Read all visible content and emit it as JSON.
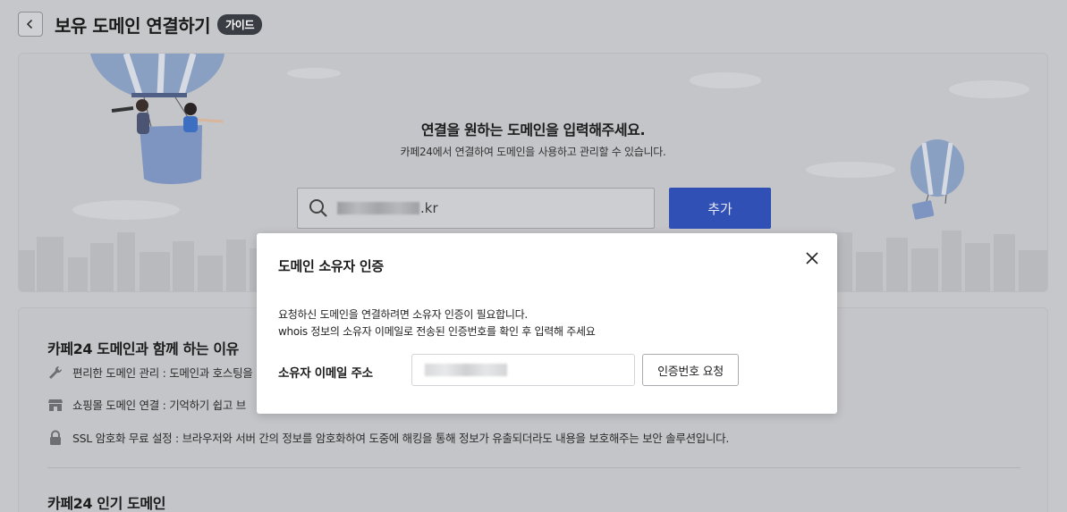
{
  "header": {
    "title": "보유 도메인 연결하기",
    "guide_badge": "가이드"
  },
  "hero": {
    "title": "연결을 원하는 도메인을 입력해주세요.",
    "subtitle": "카페24에서 연결하여 도메인을 사용하고 관리할 수 있습니다.",
    "search_suffix": ".kr",
    "add_button": "추가"
  },
  "info": {
    "title": "카페24 도메인과 함께 하는 이유",
    "benefits": [
      {
        "icon": "wrench-icon",
        "text": "편리한 도메인 관리 : 도메인과 호스팅을"
      },
      {
        "icon": "store-icon",
        "text": "쇼핑몰 도메인 연결 : 기억하기 쉽고 브"
      },
      {
        "icon": "lock-icon",
        "text": "SSL 암호화 무료 설정 : 브라우저와 서버 간의 정보를 암호화하여 도중에 해킹을 통해 정보가 유출되더라도 내용을 보호해주는 보안 솔루션입니다."
      }
    ],
    "popular_title": "카페24 인기 도메인"
  },
  "modal": {
    "title": "도메인 소유자 인증",
    "desc_line1": "요청하신 도메인을 연결하려면 소유자 인증이 필요합니다.",
    "desc_line2": "whois 정보의 소유자 이메일로 전송된 인증번호를 확인 후 입력해 주세요",
    "email_label": "소유자 이메일 주소",
    "request_button": "인증번호 요청"
  },
  "colors": {
    "primary": "#3050b5",
    "overlay_bg": "#c6c7ca",
    "badge": "#3a3d44"
  }
}
